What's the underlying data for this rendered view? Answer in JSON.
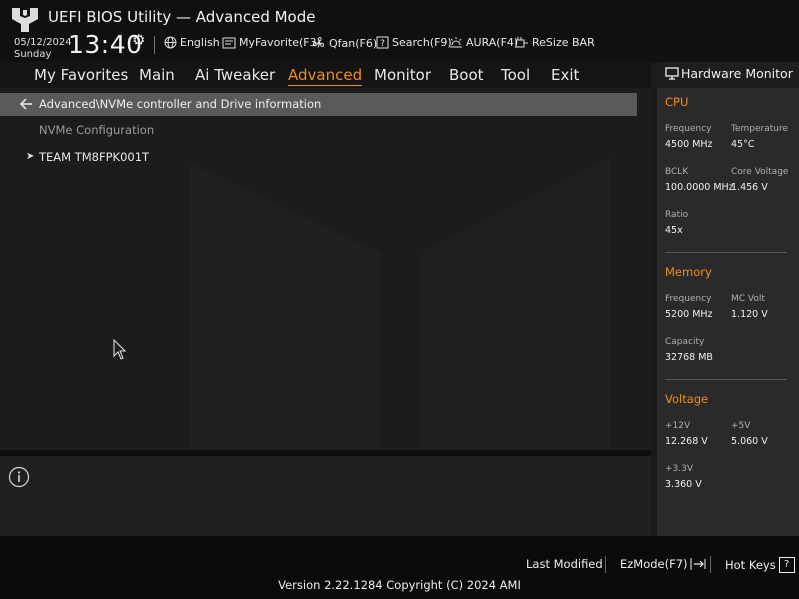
{
  "header": {
    "title": "UEFI BIOS Utility — Advanced Mode",
    "date": "05/12/2024",
    "day": "Sunday",
    "time": "13:40",
    "tools": [
      {
        "label": "English",
        "icon": "globe-icon"
      },
      {
        "label": "MyFavorite(F3)",
        "icon": "favorite-icon"
      },
      {
        "label": "Qfan(F6)",
        "icon": "fan-icon"
      },
      {
        "label": "Search(F9)",
        "icon": "search-icon"
      },
      {
        "label": "AURA(F4)",
        "icon": "aura-icon"
      },
      {
        "label": "ReSize BAR",
        "icon": "resize-bar-icon"
      }
    ]
  },
  "menu": {
    "items": [
      "My Favorites",
      "Main",
      "Ai Tweaker",
      "Advanced",
      "Monitor",
      "Boot",
      "Tool",
      "Exit"
    ],
    "active": "Advanced"
  },
  "main": {
    "breadcrumb": "Advanced\\NVMe controller and Drive information",
    "section_label": "NVMe Configuration",
    "drive": "TEAM TM8FPK001T"
  },
  "hardware_monitor": {
    "title": "Hardware Monitor",
    "cpu": {
      "heading": "CPU",
      "frequency_label": "Frequency",
      "frequency": "4500 MHz",
      "temperature_label": "Temperature",
      "temperature": "45°C",
      "bclk_label": "BCLK",
      "bclk": "100.0000 MHz",
      "core_voltage_label": "Core Voltage",
      "core_voltage": "1.456 V",
      "ratio_label": "Ratio",
      "ratio": "45x"
    },
    "memory": {
      "heading": "Memory",
      "frequency_label": "Frequency",
      "frequency": "5200 MHz",
      "mc_volt_label": "MC Volt",
      "mc_volt": "1.120 V",
      "capacity_label": "Capacity",
      "capacity": "32768 MB"
    },
    "voltage": {
      "heading": "Voltage",
      "v12_label": "+12V",
      "v12": "12.268 V",
      "v5_label": "+5V",
      "v5": "5.060 V",
      "v33_label": "+3.3V",
      "v33": "3.360 V"
    }
  },
  "footer": {
    "last_modified": "Last Modified",
    "ezmode": "EzMode(F7)",
    "hotkeys": "Hot Keys",
    "hotkeys_key": "?",
    "version": "Version 2.22.1284 Copyright (C) 2024 AMI"
  },
  "colors": {
    "accent": "#f08c1e",
    "background": "#1a1a1a",
    "selection_bar": "#5a5a5a"
  }
}
